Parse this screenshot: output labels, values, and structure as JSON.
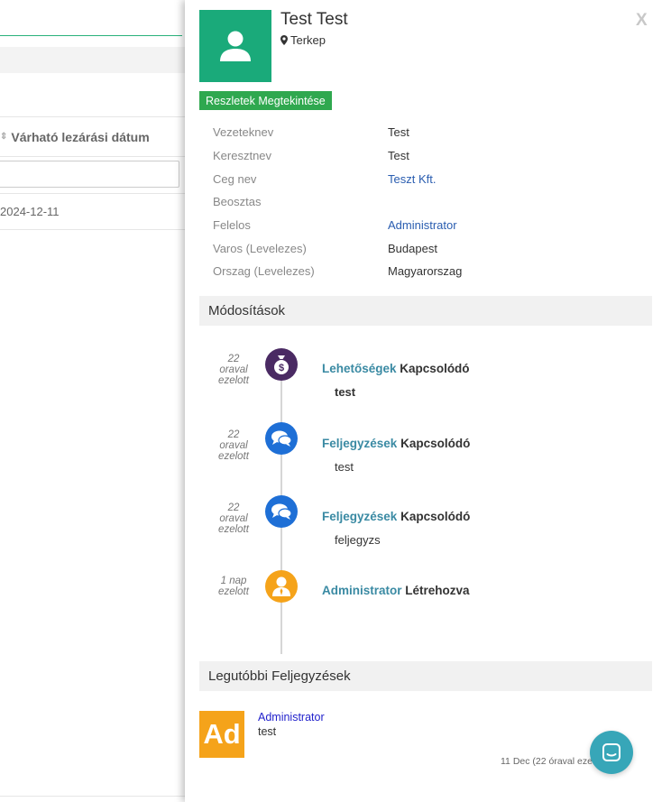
{
  "background": {
    "column_header": "Várható lezárási dátum",
    "row_date": "2024-12-11"
  },
  "contact": {
    "name": "Test Test",
    "map_link": "Terkep",
    "details_button": "Reszletek Megtekintése",
    "fields": [
      {
        "label": "Vezeteknev",
        "value": "Test"
      },
      {
        "label": "Keresztnev",
        "value": "Test"
      },
      {
        "label": "Ceg nev",
        "value": "Teszt Kft."
      },
      {
        "label": "Beosztas",
        "value": ""
      },
      {
        "label": "Felelos",
        "value": "Administrator"
      },
      {
        "label": "Varos (Levelezes)",
        "value": "Budapest"
      },
      {
        "label": "Orszag (Levelezes)",
        "value": "Magyarorszag"
      }
    ],
    "close_label": "X"
  },
  "changes": {
    "title": "Módosítások",
    "items": [
      {
        "time": [
          "22",
          "oraval",
          "ezelott"
        ],
        "link": "Lehetőségek",
        "action": "Kapcsolódó",
        "body": "test",
        "icon": "money-bag-icon",
        "color": "#4a2a63"
      },
      {
        "time": [
          "22",
          "oraval",
          "ezelott"
        ],
        "link": "Feljegyzések",
        "action": "Kapcsolódó",
        "body": "test",
        "icon": "chat-bubbles-icon",
        "color": "#1e6fd6"
      },
      {
        "time": [
          "22",
          "oraval",
          "ezelott"
        ],
        "link": "Feljegyzések",
        "action": "Kapcsolódó",
        "body": "feljegyzs",
        "icon": "chat-bubbles-icon",
        "color": "#1e6fd6"
      },
      {
        "time": [
          "1 nap",
          "ezelott"
        ],
        "link": "Administrator",
        "action": "Létrehozva",
        "body": "",
        "icon": "user-icon",
        "color": "#f5a31a"
      }
    ]
  },
  "notes": {
    "title": "Legutóbbi Feljegyzések",
    "avatar": "Ad",
    "author": "Administrator",
    "text": "test",
    "date": "11 Dec (22 óraval ezelott)"
  },
  "colors": {
    "accent_green": "#1aaa7a",
    "button_green": "#2fa84f",
    "link_blue": "#2a5db0",
    "chat_teal": "#37a6b8"
  }
}
